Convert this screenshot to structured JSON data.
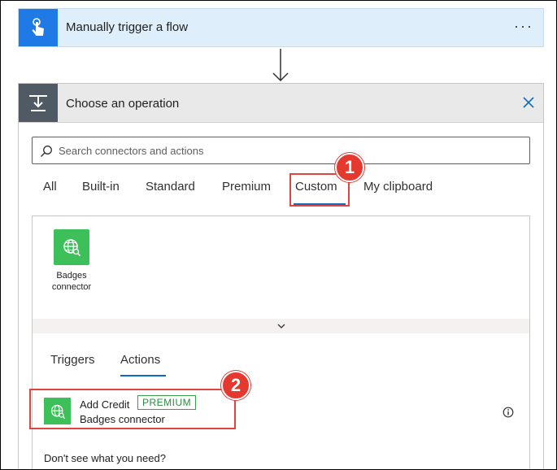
{
  "trigger": {
    "title": "Manually trigger a flow",
    "icon": "hand-touch-icon",
    "more": "···"
  },
  "operation": {
    "title": "Choose an operation",
    "icon": "operation-icon",
    "search": {
      "placeholder": "Search connectors and actions",
      "value": ""
    },
    "tabs": [
      {
        "label": "All"
      },
      {
        "label": "Built-in"
      },
      {
        "label": "Standard"
      },
      {
        "label": "Premium"
      },
      {
        "label": "Custom",
        "selected": true
      },
      {
        "label": "My clipboard"
      }
    ],
    "connectors": [
      {
        "label": "Badges connector",
        "icon": "globe-search-icon"
      }
    ],
    "sub_tabs": [
      {
        "label": "Triggers"
      },
      {
        "label": "Actions",
        "selected": true
      }
    ],
    "actions": [
      {
        "title": "Add Credit",
        "tag": "PREMIUM",
        "connector": "Badges connector",
        "icon": "globe-search-icon"
      }
    ],
    "footer_text": "Don't see what you need?"
  },
  "annotations": [
    {
      "number": "1"
    },
    {
      "number": "2"
    }
  ],
  "colors": {
    "accent": "#0f6cbd",
    "trigger_icon_bg": "#1f7ae6",
    "connector_green": "#3dbf5a",
    "highlight_red": "#e0463f"
  }
}
